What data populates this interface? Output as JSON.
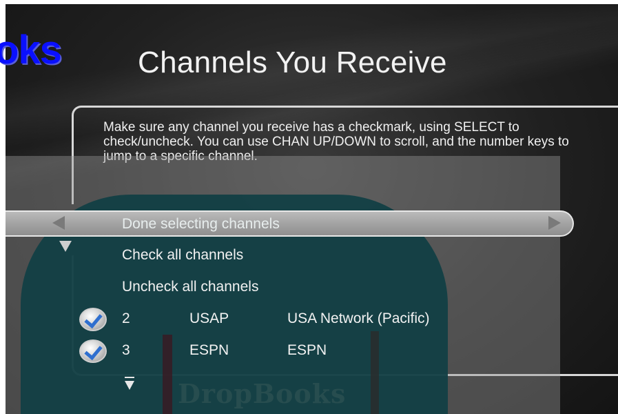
{
  "watermark": {
    "text": "oks"
  },
  "screen": {
    "title": "Channels You Receive",
    "instructions": "Make sure any channel you receive has a checkmark, using SELECT to check/uncheck. You can use CHAN UP/DOWN to scroll, and the number keys to jump to a specific channel."
  },
  "menu": {
    "done": "Done selecting channels",
    "check_all": "Check all channels",
    "uncheck_all": "Uncheck all channels",
    "selected_index": 0
  },
  "channels": [
    {
      "number": "2",
      "callsign": "USAP",
      "name": "USA Network (Pacific)",
      "checked": true
    },
    {
      "number": "3",
      "callsign": "ESPN",
      "name": "ESPN",
      "checked": true
    }
  ],
  "background_logo": {
    "text": "DropBooks"
  },
  "icons": {
    "scroll_left": "left-arrow-icon",
    "scroll_right": "right-arrow-icon",
    "scroll_up_indicator": "down-arrow-outline-icon",
    "scroll_down_indicator": "down-arrow-icon",
    "checkbox": "checkmark-icon"
  },
  "colors": {
    "title_text": "#f2f2f2",
    "watermark": "#0a10ff",
    "selection_bar": "#a3a3a3",
    "checkmark": "#2f6fcf",
    "teal_overlay": "#123f44"
  }
}
